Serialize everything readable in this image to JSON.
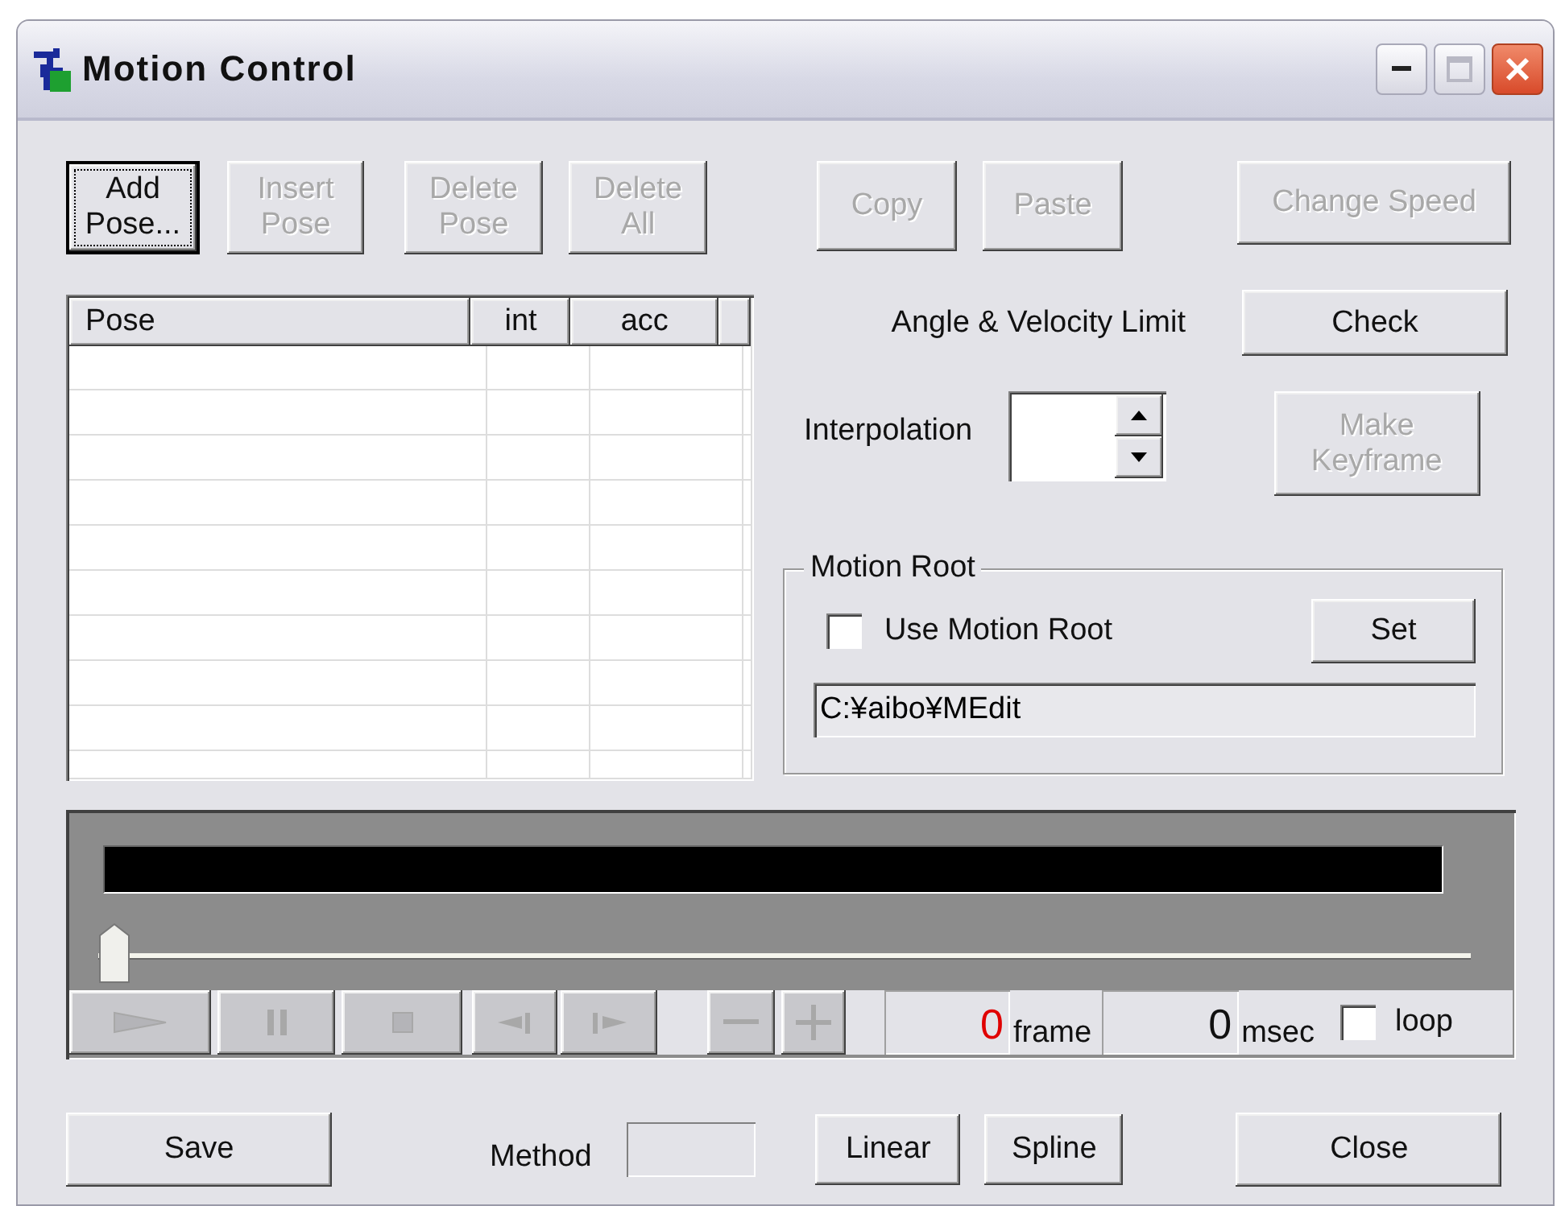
{
  "window": {
    "title": "Motion Control",
    "controls": [
      {
        "kind": "minimize",
        "disabled": false
      },
      {
        "kind": "maximize",
        "disabled": true
      },
      {
        "kind": "close",
        "disabled": false
      }
    ]
  },
  "pose_buttons": [
    {
      "label": "Add\nPose...",
      "disabled": false,
      "focused": true
    },
    {
      "label": "Insert\nPose",
      "disabled": true,
      "focused": false
    },
    {
      "label": "Delete\nPose",
      "disabled": true,
      "focused": false
    },
    {
      "label": "Delete\nAll",
      "disabled": true,
      "focused": false
    }
  ],
  "edit_buttons": [
    {
      "label": "Copy",
      "disabled": true
    },
    {
      "label": "Paste",
      "disabled": true
    }
  ],
  "change_speed": {
    "label": "Change Speed",
    "disabled": true
  },
  "table": {
    "columns": [
      "Pose",
      "int",
      "acc"
    ]
  },
  "limit": {
    "label": "Angle & Velocity Limit",
    "button": "Check"
  },
  "interpolation": {
    "label": "Interpolation"
  },
  "make_keyframe": {
    "label": "Make\nKeyframe",
    "disabled": true
  },
  "motion_root": {
    "title": "Motion Root",
    "checkbox": {
      "label": "Use Motion Root",
      "checked": false
    },
    "set_button": "Set",
    "path": "C:¥aibo¥MEdit"
  },
  "player": {
    "level": 0,
    "transport": [
      {
        "kind": "play",
        "disabled": true
      },
      {
        "kind": "pause",
        "disabled": true
      },
      {
        "kind": "stop",
        "disabled": true
      },
      {
        "kind": "step-back",
        "disabled": true
      },
      {
        "kind": "step-forward",
        "disabled": true
      },
      {
        "kind": "minus",
        "disabled": true
      },
      {
        "kind": "plus",
        "disabled": true
      }
    ],
    "frame": "0",
    "frame_unit": "frame",
    "msec": "0",
    "msec_unit": "msec",
    "loop": {
      "label": "loop",
      "checked": false
    }
  },
  "bottom": {
    "save": "Save",
    "method_label": "Method",
    "linear": "Linear",
    "spline": "Spline",
    "close": "Close"
  }
}
